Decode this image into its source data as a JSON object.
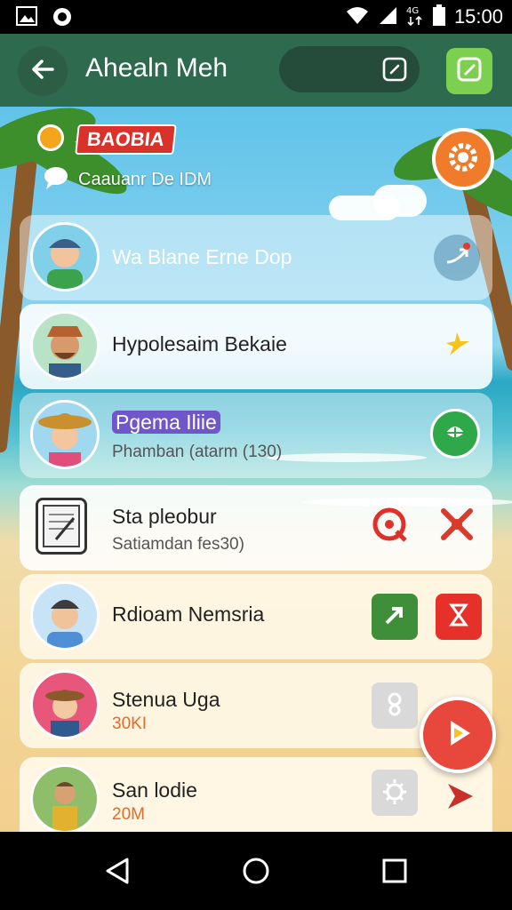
{
  "status_bar": {
    "time": "15:00",
    "icons": [
      "gallery-icon",
      "whatsapp-icon",
      "wifi-icon",
      "signal-icon",
      "data-icon",
      "battery-icon"
    ]
  },
  "app_bar": {
    "title": "Ahealn Meh",
    "back_icon": "arrow-left-icon",
    "search_icon": "edit-icon",
    "compose_icon": "compose-icon"
  },
  "header": {
    "badge": "BAOBIA",
    "subheading": "Caauanr De IDM",
    "settings_icon": "gear-icon"
  },
  "contacts": [
    {
      "name": "Wa Blane Erne Dop",
      "subtitle": "",
      "action_icons": [
        "shuffle-icon"
      ]
    },
    {
      "name": "Hypolesaim Bekaie",
      "subtitle": "",
      "action_icons": [
        "sparkle-icon"
      ]
    },
    {
      "name": "Pgema Iliie",
      "subtitle": "Phamban (atarm (130)",
      "action_icons": [
        "leaf-icon"
      ]
    },
    {
      "name": "Sta pleobur",
      "subtitle": "Satiamdan fes30)",
      "action_icons": [
        "target-icon",
        "tools-icon"
      ]
    },
    {
      "name": "Rdioam Nemsria",
      "subtitle": "",
      "action_icons": [
        "share-icon",
        "hourglass-icon"
      ]
    },
    {
      "name": "Stenua Uga",
      "subtitle": "30KI",
      "action_icons": [
        "location-icon",
        "play-icon"
      ]
    },
    {
      "name": "San lodie",
      "subtitle": "20M",
      "action_icons": [
        "settings-icon",
        "forward-icon"
      ]
    }
  ],
  "fab": {
    "icon": "play-icon"
  },
  "nav_bar": {
    "icons": [
      "back-triangle-icon",
      "home-circle-icon",
      "recents-square-icon"
    ]
  },
  "colors": {
    "app_bar": "#2e6a4e",
    "compose_button": "#7ccf4f",
    "settings_fab": "#f07c2b",
    "play_fab": "#e8483b",
    "badge": "#d8322a",
    "name_highlight": "#6f56c9"
  }
}
